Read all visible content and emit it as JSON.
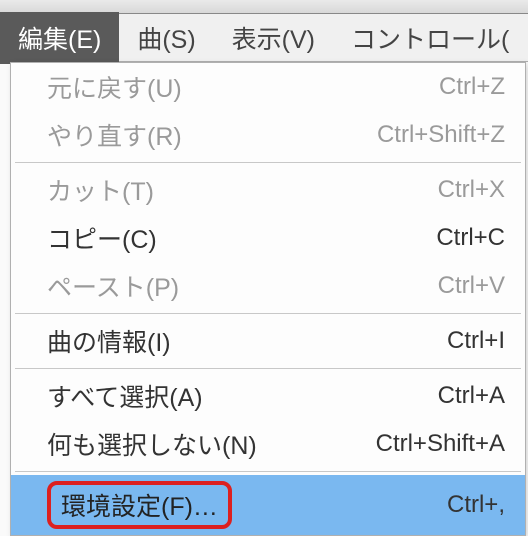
{
  "menubar": {
    "edit": "編集(E)",
    "song": "曲(S)",
    "view": "表示(V)",
    "control": "コントロール("
  },
  "menu": {
    "undo": {
      "label": "元に戻す(U)",
      "shortcut": "Ctrl+Z"
    },
    "redo": {
      "label": "やり直す(R)",
      "shortcut": "Ctrl+Shift+Z"
    },
    "cut": {
      "label": "カット(T)",
      "shortcut": "Ctrl+X"
    },
    "copy": {
      "label": "コピー(C)",
      "shortcut": "Ctrl+C"
    },
    "paste": {
      "label": "ペースト(P)",
      "shortcut": "Ctrl+V"
    },
    "songinfo": {
      "label": "曲の情報(I)",
      "shortcut": "Ctrl+I"
    },
    "selectall": {
      "label": "すべて選択(A)",
      "shortcut": "Ctrl+A"
    },
    "selectnone": {
      "label": "何も選択しない(N)",
      "shortcut": "Ctrl+Shift+A"
    },
    "preferences": {
      "label": "環境設定(F)…",
      "shortcut": "Ctrl+,"
    }
  }
}
